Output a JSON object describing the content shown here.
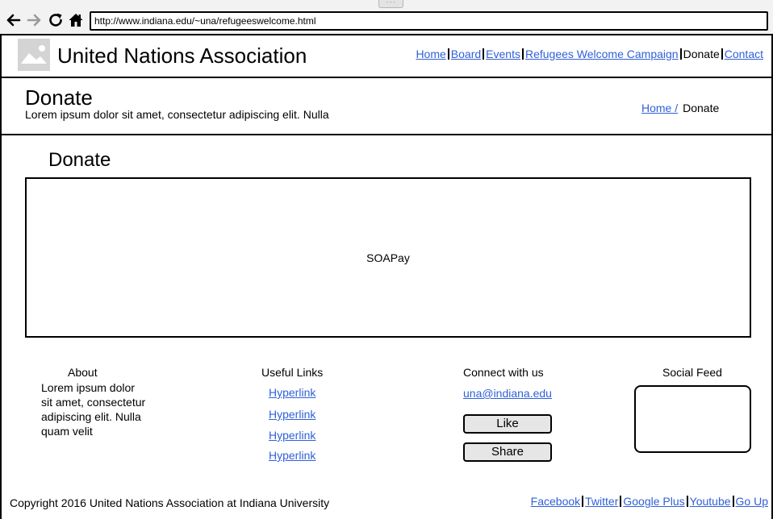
{
  "browser": {
    "url": "http://www.indiana.edu/~una/refugeeswelcome.html",
    "grip_label": "- - -"
  },
  "header": {
    "site_title": "United Nations Association",
    "logo_icon": "image-placeholder-icon",
    "nav": [
      {
        "label": "Home"
      },
      {
        "label": "Board"
      },
      {
        "label": "Events"
      },
      {
        "label": "Refugees Welcome Campaign"
      },
      {
        "label": "Donate"
      },
      {
        "label": "Contact"
      }
    ]
  },
  "banner": {
    "title": "Donate",
    "subtitle": "Lorem ipsum dolor sit amet, consectetur adipiscing elit. Nulla",
    "breadcrumb": {
      "home": "Home /",
      "current": "Donate"
    }
  },
  "main": {
    "heading": "Donate",
    "payment_widget": "SOAPay"
  },
  "footer": {
    "about": {
      "title": "About",
      "text": "Lorem ipsum dolor sit amet, consectetur adipiscing elit. Nulla quam velit"
    },
    "useful_links": {
      "title": "Useful Links",
      "links": [
        "Hyperlink",
        "Hyperlink",
        "Hyperlink",
        "Hyperlink"
      ]
    },
    "connect": {
      "title": "Connect with us",
      "email": "una@indiana.edu",
      "like_label": "Like",
      "share_label": "Share"
    },
    "social_feed": {
      "title": "Social Feed"
    },
    "copyright": "Copyright 2016 United Nations Association at Indiana University",
    "links": [
      "Facebook",
      "Twitter",
      "Google Plus",
      "Youtube",
      "Go Up"
    ]
  },
  "colors": {
    "link": "#3060d8",
    "chrome": "#f2f2f2",
    "button": "#e6e6e6"
  }
}
